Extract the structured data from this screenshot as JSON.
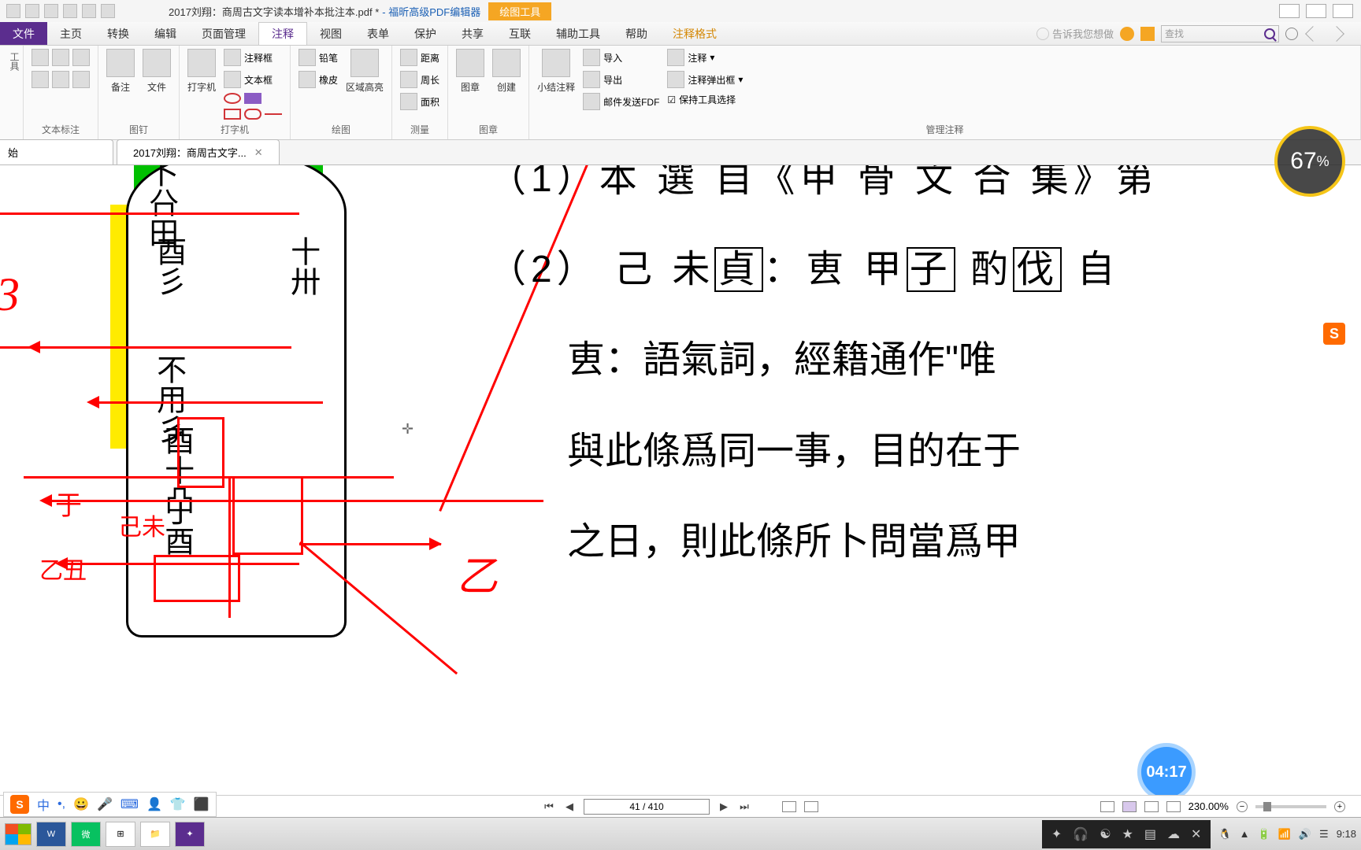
{
  "titlebar": {
    "filename": "2017刘翔：商周古文字读本增补本批注本.pdf *",
    "appname": "- 福昕高级PDF编辑器",
    "contextual": "绘图工具"
  },
  "maintabs": {
    "file": "文件",
    "items": [
      "主页",
      "转换",
      "编辑",
      "页面管理",
      "注释",
      "视图",
      "表单",
      "保护",
      "共享",
      "互联",
      "辅助工具",
      "帮助",
      "注释格式"
    ],
    "active_index": 4,
    "tell_me": "告诉我您想做",
    "search_placeholder": "查找"
  },
  "ribbon": {
    "groups": {
      "tools_label": "工具",
      "text_markup": {
        "label": "文本标注"
      },
      "pushpin": {
        "note": "备注",
        "file": "文件",
        "label": "图钉"
      },
      "typewriter": {
        "btn": "打字机",
        "label": "打字机"
      },
      "callout": "注释框",
      "textbox": "文本框",
      "drawing": {
        "pencil": "铅笔",
        "eraser": "橡皮",
        "area": "区域高亮",
        "label": "绘图"
      },
      "measure": {
        "distance": "距离",
        "perimeter": "周长",
        "area": "面积",
        "label": "测量"
      },
      "stamps": {
        "stamp": "图章",
        "create": "创建",
        "label": "图章"
      },
      "manage": {
        "summary": "小结注释",
        "import": "导入",
        "export": "导出",
        "sendfdf": "邮件发送FDF",
        "comments": "注释",
        "popup": "注释弹出框",
        "keeptool": "保持工具选择",
        "label": "管理注释"
      }
    }
  },
  "doctabs": {
    "home": "始",
    "current": "2017刘翔：商周古文字..."
  },
  "document": {
    "line1_prefix": "（1）本",
    "line2_a": "（2）",
    "line2_b": "己 未",
    "line2_zhen": "貞",
    "line2_c": "：叀 甲",
    "line2_zi": "子",
    "line2_d": " 酌",
    "line2_fa": "伐",
    "line3": "叀：語氣詞，經籍通作\"唯",
    "line4": "與此條爲同一事，目的在于",
    "line5": "之日，則此條所卜問當爲甲",
    "ann_yu": "于",
    "ann_jiwei": "己未",
    "ann_yichou": "乙丑",
    "ann_3": "3",
    "ann_z": "乙"
  },
  "pagenav": {
    "page": "41 / 410",
    "zoom": "230.00%"
  },
  "ime": {
    "mode": "中",
    "punct": "•,",
    "items": [
      "😀",
      "🎤",
      "⌨",
      "👤",
      "👕",
      "⬛"
    ]
  },
  "overlay": {
    "battery": "67",
    "timer": "04:17"
  },
  "taskbar": {
    "time": "9:18",
    "date_icons": [
      "▲",
      "🔋",
      "📶",
      "🔊",
      "☰"
    ]
  }
}
